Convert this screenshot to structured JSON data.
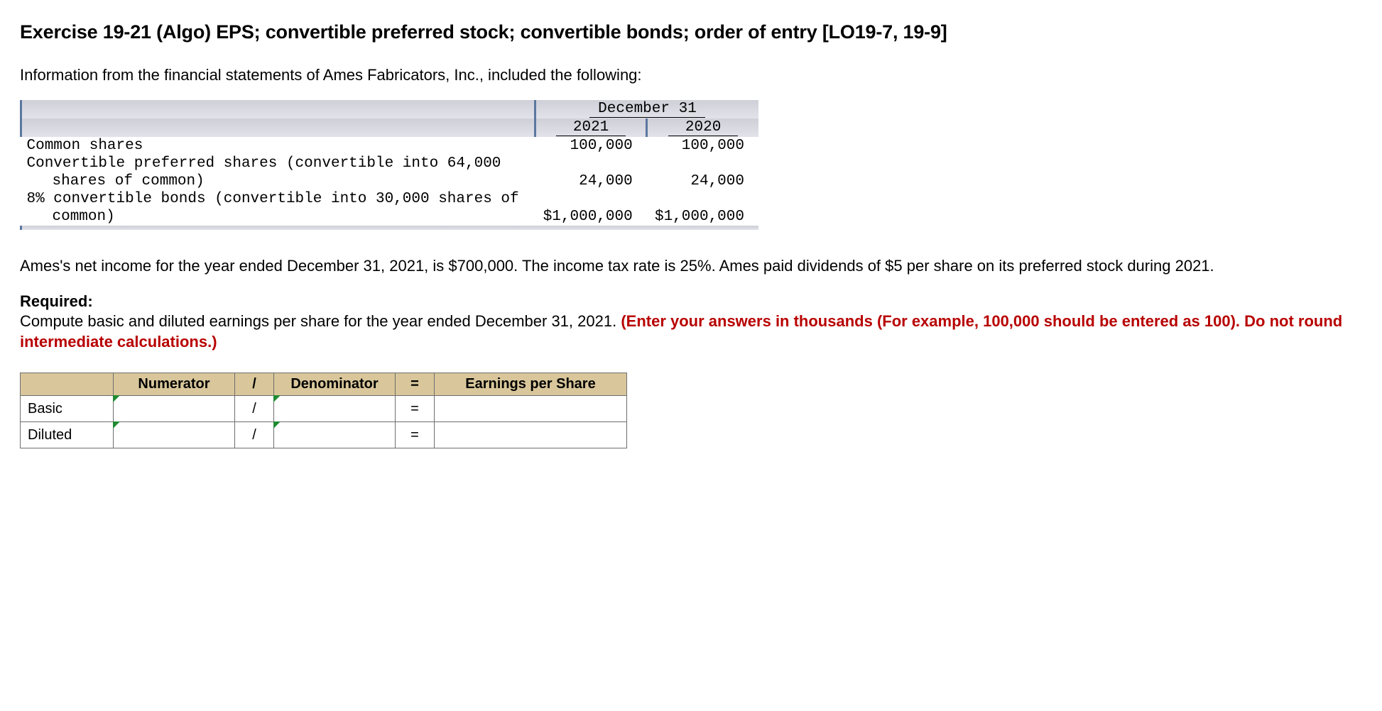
{
  "title": "Exercise 19-21 (Algo) EPS; convertible preferred stock; convertible bonds; order of entry [LO19-7, 19-9]",
  "intro": "Information from the financial statements of Ames Fabricators, Inc., included the following:",
  "fin": {
    "date_header": "December 31",
    "years": {
      "y1": "2021",
      "y2": "2020"
    },
    "rows": {
      "common": {
        "label": "Common shares",
        "y1": "100,000",
        "y2": "100,000"
      },
      "pref1": {
        "label": "Convertible preferred shares (convertible into 64,000"
      },
      "pref2": {
        "label": "shares of common)",
        "y1": "24,000",
        "y2": "24,000"
      },
      "bond1": {
        "label": "8% convertible bonds (convertible into 30,000 shares of"
      },
      "bond2": {
        "label": "common)",
        "y1": "$1,000,000",
        "y2": "$1,000,000"
      }
    }
  },
  "para_netincome": "Ames's net income for the year ended December 31, 2021, is $700,000. The income tax rate is 25%. Ames paid dividends of $5 per share on its preferred stock during 2021.",
  "req": {
    "label": "Required:",
    "text_plain": "Compute basic and diluted earnings per share for the year ended December 31, 2021. ",
    "text_red": "(Enter your answers in thousands (For example, 100,000 should be entered as 100). Do not round intermediate calculations.)"
  },
  "ans": {
    "headers": {
      "num": "Numerator",
      "div": "/",
      "den": "Denominator",
      "eq": "=",
      "eps": "Earnings per Share"
    },
    "rows": {
      "basic": {
        "label": "Basic",
        "div": "/",
        "eq": "="
      },
      "diluted": {
        "label": "Diluted",
        "div": "/",
        "eq": "="
      }
    }
  }
}
